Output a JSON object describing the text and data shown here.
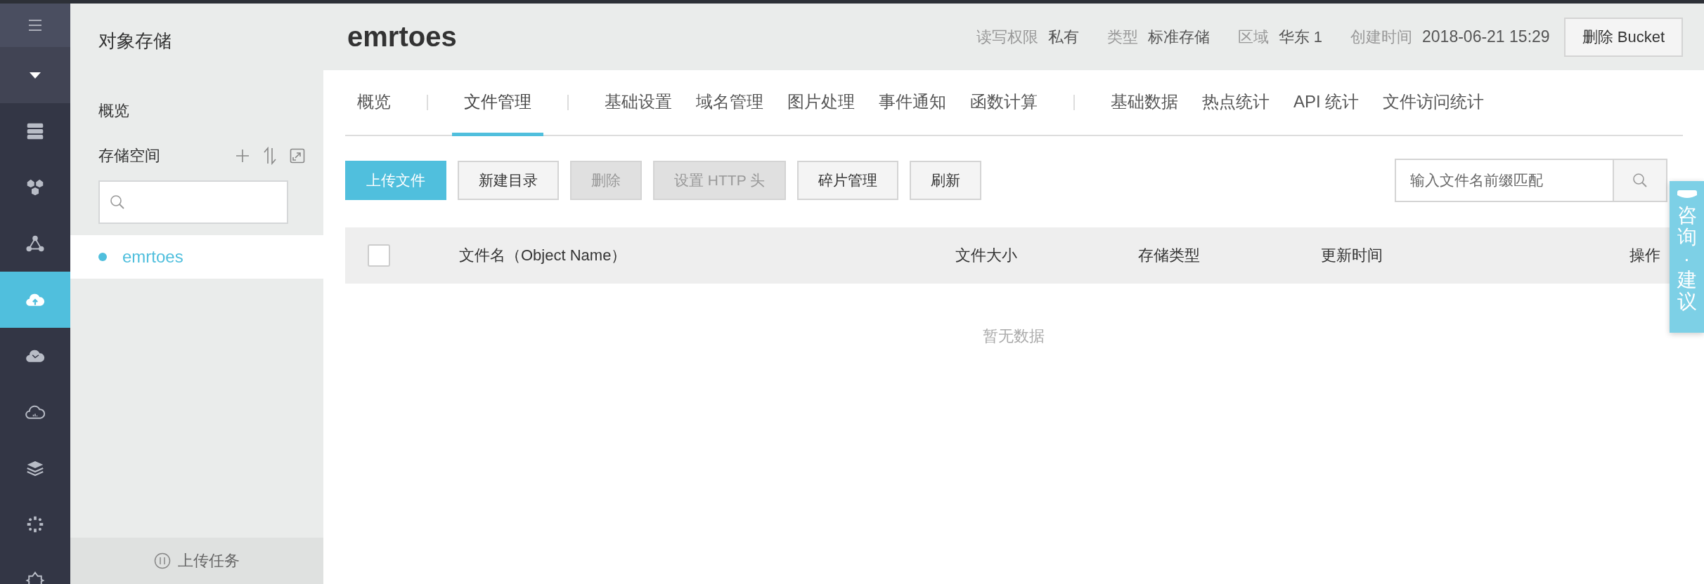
{
  "nav_rail": {
    "items": [
      {
        "kind": "servers",
        "selected": false
      },
      {
        "kind": "hexagons",
        "selected": false
      },
      {
        "kind": "network",
        "selected": false
      },
      {
        "kind": "cloud-upload",
        "selected": true
      },
      {
        "kind": "cloud-map",
        "selected": false
      },
      {
        "kind": "cloud-chart",
        "selected": false
      },
      {
        "kind": "layers",
        "selected": false
      },
      {
        "kind": "dots-ring",
        "selected": false
      },
      {
        "kind": "gear-frame",
        "selected": false
      }
    ]
  },
  "sidebar": {
    "title": "对象存储",
    "overview": "概览",
    "section": "存储空间",
    "buckets": [
      {
        "name": "emrtoes",
        "selected": true
      }
    ],
    "footer": "上传任务"
  },
  "header": {
    "title": "emrtoes",
    "meta": [
      {
        "label": "读写权限",
        "value": "私有"
      },
      {
        "label": "类型",
        "value": "标准存储"
      },
      {
        "label": "区域",
        "value": "华东 1"
      },
      {
        "label": "创建时间",
        "value": "2018-06-21 15:29"
      }
    ],
    "action": "删除 Bucket"
  },
  "tab_groups": [
    [
      {
        "label": "概览",
        "selected": false
      }
    ],
    [
      {
        "label": "文件管理",
        "selected": true
      }
    ],
    [
      {
        "label": "基础设置",
        "selected": false
      },
      {
        "label": "域名管理",
        "selected": false
      },
      {
        "label": "图片处理",
        "selected": false
      },
      {
        "label": "事件通知",
        "selected": false
      },
      {
        "label": "函数计算",
        "selected": false
      }
    ],
    [
      {
        "label": "基础数据",
        "selected": false
      },
      {
        "label": "热点统计",
        "selected": false
      },
      {
        "label": "API 统计",
        "selected": false
      },
      {
        "label": "文件访问统计",
        "selected": false
      }
    ]
  ],
  "toolbar": {
    "buttons": [
      {
        "label": "上传文件",
        "kind": "primary",
        "disabled": false
      },
      {
        "label": "新建目录",
        "kind": "default",
        "disabled": false
      },
      {
        "label": "删除",
        "kind": "default",
        "disabled": true
      },
      {
        "label": "设置 HTTP 头",
        "kind": "default",
        "disabled": true
      },
      {
        "label": "碎片管理",
        "kind": "default",
        "disabled": false
      },
      {
        "label": "刷新",
        "kind": "default",
        "disabled": false
      }
    ],
    "search": {
      "placeholder": "输入文件名前缀匹配"
    }
  },
  "table": {
    "select_all": {
      "checked": false
    },
    "columns": [
      "文件名（Object Name）",
      "文件大小",
      "存储类型",
      "更新时间",
      "操作"
    ],
    "empty_text": "暂无数据"
  },
  "feedback_tab": {
    "label": "咨询·建议"
  }
}
